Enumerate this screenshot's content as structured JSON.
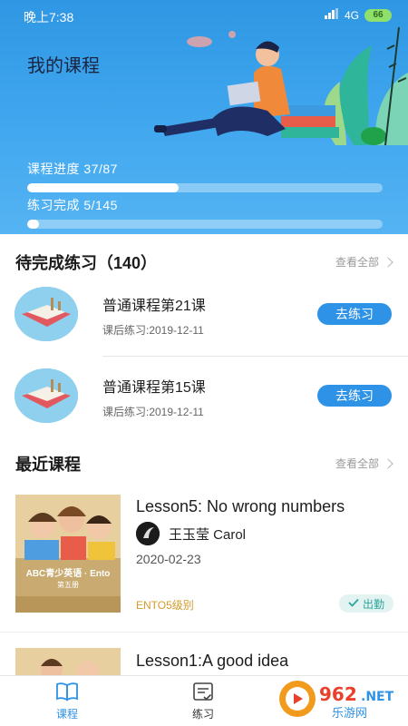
{
  "status": {
    "time": "晚上7:38",
    "network": "4G",
    "battery": "66"
  },
  "page_title": "我的课程",
  "progress": [
    {
      "label": "课程进度 37/87",
      "value": 0.425
    },
    {
      "label": "练习完成 5/145",
      "value": 0.034
    }
  ],
  "pending": {
    "title": "待完成练习（140）",
    "see_all": "查看全部",
    "items": [
      {
        "title": "普通课程第21课",
        "subtitle": "课后练习:2019-12-11",
        "button": "去练习"
      },
      {
        "title": "普通课程第15课",
        "subtitle": "课后练习:2019-12-11",
        "button": "去练习"
      }
    ]
  },
  "recent": {
    "title": "最近课程",
    "see_all": "查看全部",
    "courses": [
      {
        "title": "Lesson5:  No wrong numbers",
        "teacher": "王玉莹  Carol",
        "date": "2020-02-23",
        "level": "ENTO5级别",
        "status": "出勤",
        "cover_title": "ABC青少英语 · Ento",
        "cover_sub": "第五册"
      },
      {
        "title": "Lesson1:A good idea"
      }
    ]
  },
  "tabs": [
    {
      "label": "课程",
      "active": true
    },
    {
      "label": "练习",
      "active": false
    }
  ],
  "watermark": {
    "text": "962.NET",
    "sub": "乐游网"
  },
  "colors": {
    "primary": "#2e92e6",
    "header": "#3fa6ee",
    "level": "#d59b2b",
    "attend": "#2aa59b"
  }
}
